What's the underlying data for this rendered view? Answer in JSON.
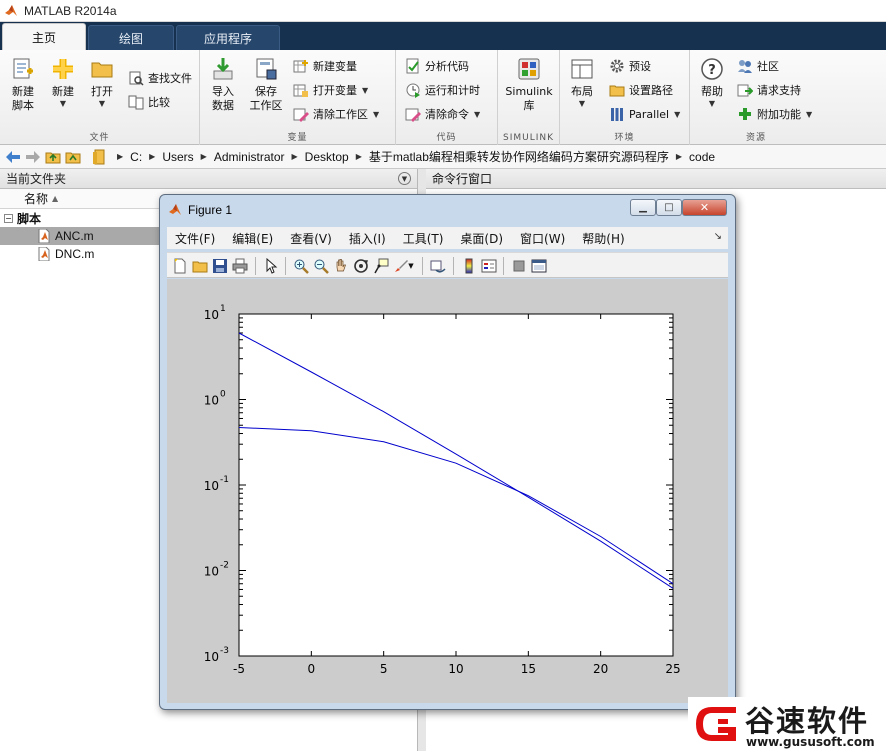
{
  "app": {
    "title": "MATLAB R2014a"
  },
  "ribbon_tabs": [
    {
      "label": "主页",
      "active": true
    },
    {
      "label": "绘图",
      "active": false
    },
    {
      "label": "应用程序",
      "active": false
    }
  ],
  "ribbon": {
    "file": {
      "group_label": "文件",
      "new_script": "新建\n脚本",
      "new": "新建",
      "open": "打开",
      "find_files": "查找文件",
      "compare": "比较"
    },
    "variable": {
      "group_label": "变量",
      "import": "导入\n数据",
      "save_workspace": "保存\n工作区",
      "new_variable": "新建变量",
      "open_variable": "打开变量",
      "clear_workspace": "清除工作区"
    },
    "code": {
      "group_label": "代码",
      "analyze": "分析代码",
      "run_time": "运行和计时",
      "clear_commands": "清除命令"
    },
    "simulink": {
      "group_label": "SIMULINK",
      "library": "Simulink\n库"
    },
    "environment": {
      "group_label": "环境",
      "layout": "布局",
      "preferences": "预设",
      "set_path": "设置路径",
      "parallel": "Parallel"
    },
    "resources": {
      "group_label": "资源",
      "help": "帮助",
      "community": "社区",
      "request_support": "请求支持",
      "addons": "附加功能"
    }
  },
  "address_path": [
    "C:",
    "Users",
    "Administrator",
    "Desktop",
    "基于matlab编程相乘转发协作网络编码方案研究源码程序",
    "code"
  ],
  "current_folder": {
    "title": "当前文件夹",
    "column_name": "名称",
    "group": "脚本",
    "files": [
      {
        "name": "ANC.m",
        "selected": true
      },
      {
        "name": "DNC.m",
        "selected": false
      }
    ]
  },
  "command_window": {
    "title": "命令行窗口"
  },
  "figure": {
    "title": "Figure 1",
    "menus": [
      "文件(F)",
      "编辑(E)",
      "查看(V)",
      "插入(I)",
      "工具(T)",
      "桌面(D)",
      "窗口(W)",
      "帮助(H)"
    ]
  },
  "chart_data": {
    "type": "line",
    "title": "",
    "xlabel": "",
    "ylabel": "",
    "yscale": "log",
    "xlim": [
      -5,
      25
    ],
    "ylim": [
      0.001,
      10
    ],
    "x_ticks": [
      -5,
      0,
      5,
      10,
      15,
      20,
      25
    ],
    "y_ticks": [
      0.001,
      0.01,
      0.1,
      1,
      10
    ],
    "y_tick_labels": [
      {
        "base": "10",
        "exp": "-3"
      },
      {
        "base": "10",
        "exp": "-2"
      },
      {
        "base": "10",
        "exp": "-1"
      },
      {
        "base": "10",
        "exp": "0"
      },
      {
        "base": "10",
        "exp": "1"
      }
    ],
    "grid": false,
    "line_color": "#0000cc",
    "x": [
      -5,
      0,
      5,
      10,
      15,
      20,
      25
    ],
    "series": [
      {
        "values": [
          6.0,
          2.1,
          0.72,
          0.23,
          0.072,
          0.022,
          0.0062
        ]
      },
      {
        "values": [
          0.47,
          0.43,
          0.32,
          0.18,
          0.075,
          0.025,
          0.007
        ]
      }
    ]
  },
  "watermark": {
    "title": "谷速软件",
    "url": "www.gususoft.com",
    "accent": "#e01010"
  }
}
